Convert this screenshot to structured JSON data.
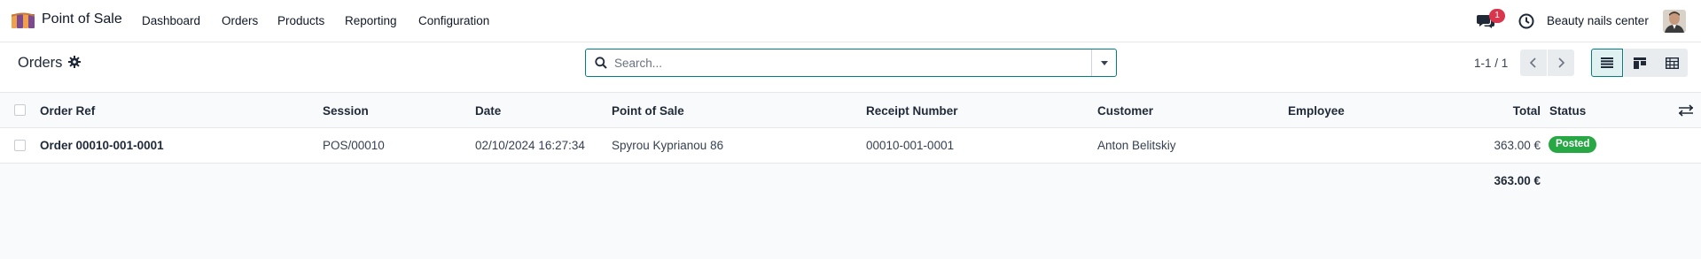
{
  "app": {
    "name": "Point of Sale",
    "menu": [
      "Dashboard",
      "Orders",
      "Products",
      "Reporting",
      "Configuration"
    ],
    "notifications_count": "1",
    "company": "Beauty nails center",
    "colors": {
      "accent": "#017e84",
      "badge": "#d9364d",
      "posted": "#28a745"
    }
  },
  "control": {
    "breadcrumb": "Orders",
    "search_placeholder": "Search...",
    "pager": "1-1 / 1"
  },
  "table": {
    "columns": [
      "Order Ref",
      "Session",
      "Date",
      "Point of Sale",
      "Receipt Number",
      "Customer",
      "Employee",
      "Total",
      "Status"
    ],
    "rows": [
      {
        "order_ref": "Order 00010-001-0001",
        "session": "POS/00010",
        "date": "02/10/2024 16:27:34",
        "point_of_sale": "Spyrou Kyprianou 86",
        "receipt_number": "00010-001-0001",
        "customer": "Anton Belitskiy",
        "employee": "",
        "total": "363.00 €",
        "status": "Posted"
      }
    ],
    "footer_total": "363.00 €"
  },
  "icons": [
    "app-logo-icon",
    "chat-icon",
    "clock-icon",
    "gear-icon",
    "search-icon",
    "chevron-left-icon",
    "chevron-right-icon",
    "list-view-icon",
    "kanban-view-icon",
    "pivot-view-icon",
    "optional-columns-icon"
  ]
}
